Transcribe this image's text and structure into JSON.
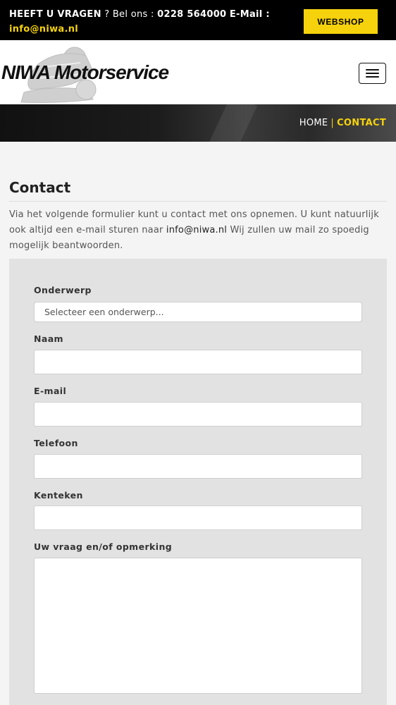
{
  "topbar": {
    "question": "HEEFT U VRAGEN",
    "bel_ons": "? Bel ons :",
    "phone": "0228 564000",
    "email_label": "E-Mail :",
    "email": "info@niwa.nl",
    "webshop_label": "WEBSHOP"
  },
  "header": {
    "logo_text": "NIWA Motorservice"
  },
  "breadcrumb": {
    "home": "HOME",
    "separator": "|",
    "current": "CONTACT"
  },
  "page": {
    "title": "Contact",
    "intro_part1": "Via het volgende formulier kunt u contact met ons opnemen. U kunt natuurlijk ook altijd een e-mail sturen naar",
    "intro_email": "info@niwa.nl",
    "intro_part2": "Wij zullen uw mail zo spoedig mogelijk beantwoorden."
  },
  "form": {
    "subject_label": "Onderwerp",
    "subject_value": "Selecteer een onderwerp...",
    "name_label": "Naam",
    "email_label": "E-mail",
    "phone_label": "Telefoon",
    "plate_label": "Kenteken",
    "message_label": "Uw vraag en/of opmerking"
  },
  "colors": {
    "accent": "#f5d20c",
    "topbar_bg": "#000000",
    "form_bg": "#e2e2e2"
  },
  "icons": [
    "hamburger-menu-icon",
    "motorcycle-rider-logo-icon"
  ]
}
